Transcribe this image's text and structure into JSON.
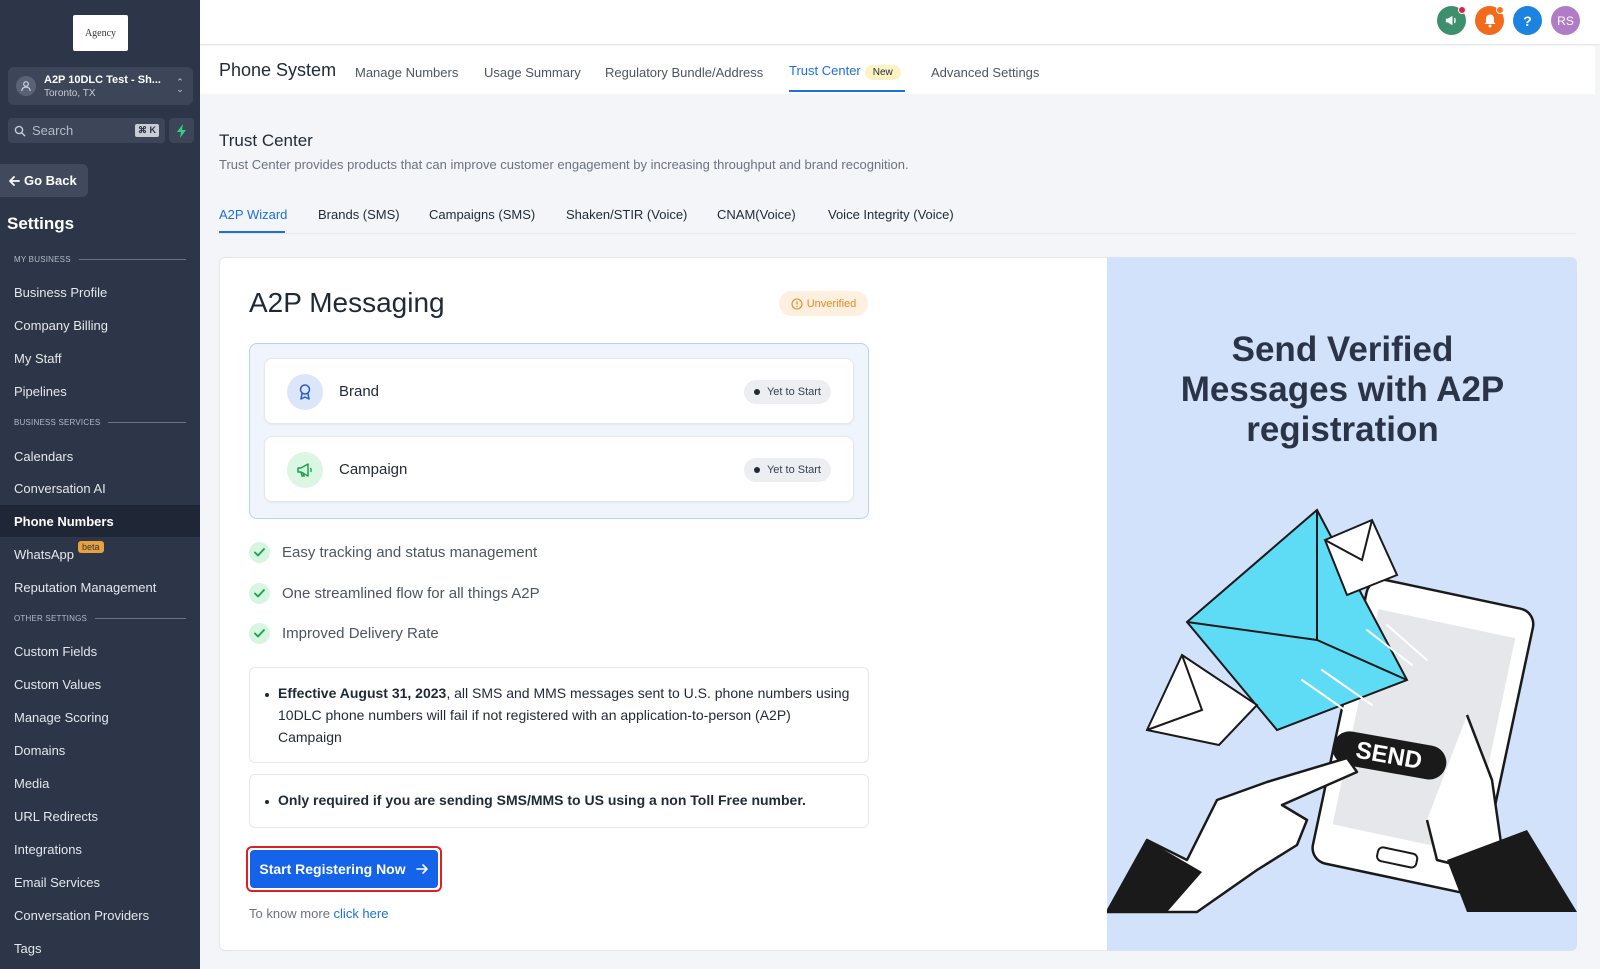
{
  "sidebar": {
    "logo_text": "Agency",
    "location": {
      "name": "A2P 10DLC Test - Sh...",
      "city": "Toronto, TX"
    },
    "search": {
      "placeholder": "Search",
      "shortcut": "⌘ K"
    },
    "go_back": "Go Back",
    "title": "Settings",
    "sections": {
      "my_business": "MY BUSINESS",
      "business_services": "BUSINESS SERVICES",
      "other_settings": "OTHER SETTINGS"
    },
    "items": [
      {
        "label": "Business Profile"
      },
      {
        "label": "Company Billing"
      },
      {
        "label": "My Staff"
      },
      {
        "label": "Pipelines"
      },
      {
        "label": "Calendars"
      },
      {
        "label": "Conversation AI"
      },
      {
        "label": "Phone Numbers",
        "active": true
      },
      {
        "label": "WhatsApp",
        "badge": "beta"
      },
      {
        "label": "Reputation Management"
      },
      {
        "label": "Custom Fields"
      },
      {
        "label": "Custom Values"
      },
      {
        "label": "Manage Scoring"
      },
      {
        "label": "Domains"
      },
      {
        "label": "Media"
      },
      {
        "label": "URL Redirects"
      },
      {
        "label": "Integrations"
      },
      {
        "label": "Email Services"
      },
      {
        "label": "Conversation Providers"
      },
      {
        "label": "Tags"
      }
    ]
  },
  "topbar": {
    "icons": [
      "megaphone-icon",
      "bell-icon",
      "help-icon"
    ],
    "help_glyph": "?",
    "avatar": "RS",
    "colors": {
      "megaphone": "#3d8f6e",
      "bell": "#f26b1d",
      "help": "#1d83e0",
      "avatar": "#b07cc6"
    }
  },
  "subnav": {
    "title": "Phone System",
    "tabs": [
      {
        "label": "Manage Numbers"
      },
      {
        "label": "Usage Summary"
      },
      {
        "label": "Regulatory Bundle/Address"
      },
      {
        "label": "Trust Center",
        "badge": "New",
        "active": true
      },
      {
        "label": "Advanced Settings"
      }
    ]
  },
  "trust_center": {
    "title": "Trust Center",
    "description": "Trust Center provides products that can improve customer engagement by increasing throughput and brand recognition.",
    "tabs": [
      {
        "label": "A2P Wizard",
        "active": true
      },
      {
        "label": "Brands (SMS)"
      },
      {
        "label": "Campaigns (SMS)"
      },
      {
        "label": "Shaken/STIR (Voice)"
      },
      {
        "label": "CNAM(Voice)"
      },
      {
        "label": "Voice Integrity (Voice)"
      }
    ]
  },
  "a2p": {
    "title": "A2P Messaging",
    "status": "Unverified",
    "steps": [
      {
        "label": "Brand",
        "status": "Yet to Start",
        "icon": "award-icon"
      },
      {
        "label": "Campaign",
        "status": "Yet to Start",
        "icon": "megaphone-icon"
      }
    ],
    "features": [
      "Easy tracking and status management",
      "One streamlined flow for all things A2P",
      "Improved Delivery Rate"
    ],
    "notice1": {
      "bold": "Effective August 31, 2023",
      "rest": ", all SMS and MMS messages sent to U.S. phone numbers using 10DLC phone numbers will fail if not registered with an application-to-person (A2P) Campaign"
    },
    "notice2": "Only required if you are sending SMS/MMS to US using a non Toll Free number.",
    "cta": "Start Registering Now",
    "know_more": "To know more",
    "know_more_link": "click here"
  },
  "hero": {
    "title": "Send Verified Messages with A2P registration",
    "send_label": "SEND"
  },
  "colors": {
    "accent": "#1d6fe0",
    "sidebar_bg": "#2c3648",
    "hero_bg": "#d2e2fb",
    "envelope": "#5fdcf5",
    "cta_outline": "#e11d26"
  }
}
